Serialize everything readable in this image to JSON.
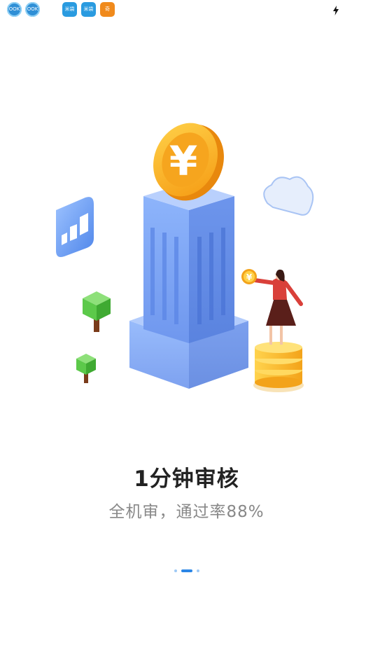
{
  "status_bar": {
    "icons": [
      {
        "name": "app-notification-icon-1",
        "label": "OOK"
      },
      {
        "name": "app-notification-icon-2",
        "label": "OOK"
      },
      {
        "name": "app-notification-icon-3",
        "label": "米袋"
      },
      {
        "name": "app-notification-icon-4",
        "label": "米袋"
      },
      {
        "name": "app-notification-icon-5",
        "label": "奇"
      }
    ],
    "charging_icon": "lightning-bolt-icon"
  },
  "illustration": {
    "coin_symbol": "¥",
    "small_coin_symbol": "¥",
    "colors": {
      "building": "#7aa6f4",
      "coin": "#f7a821",
      "coin_face": "#ffffff",
      "tree": "#5cc94a",
      "cloud": "#cfe0fb",
      "skirt": "#5a1f1a",
      "shirt": "#d9403a"
    }
  },
  "content": {
    "title": "1分钟审核",
    "subtitle": "全机审，通过率88%"
  },
  "pager": {
    "total": 3,
    "active_index": 1,
    "accent": "#2b86e6"
  }
}
